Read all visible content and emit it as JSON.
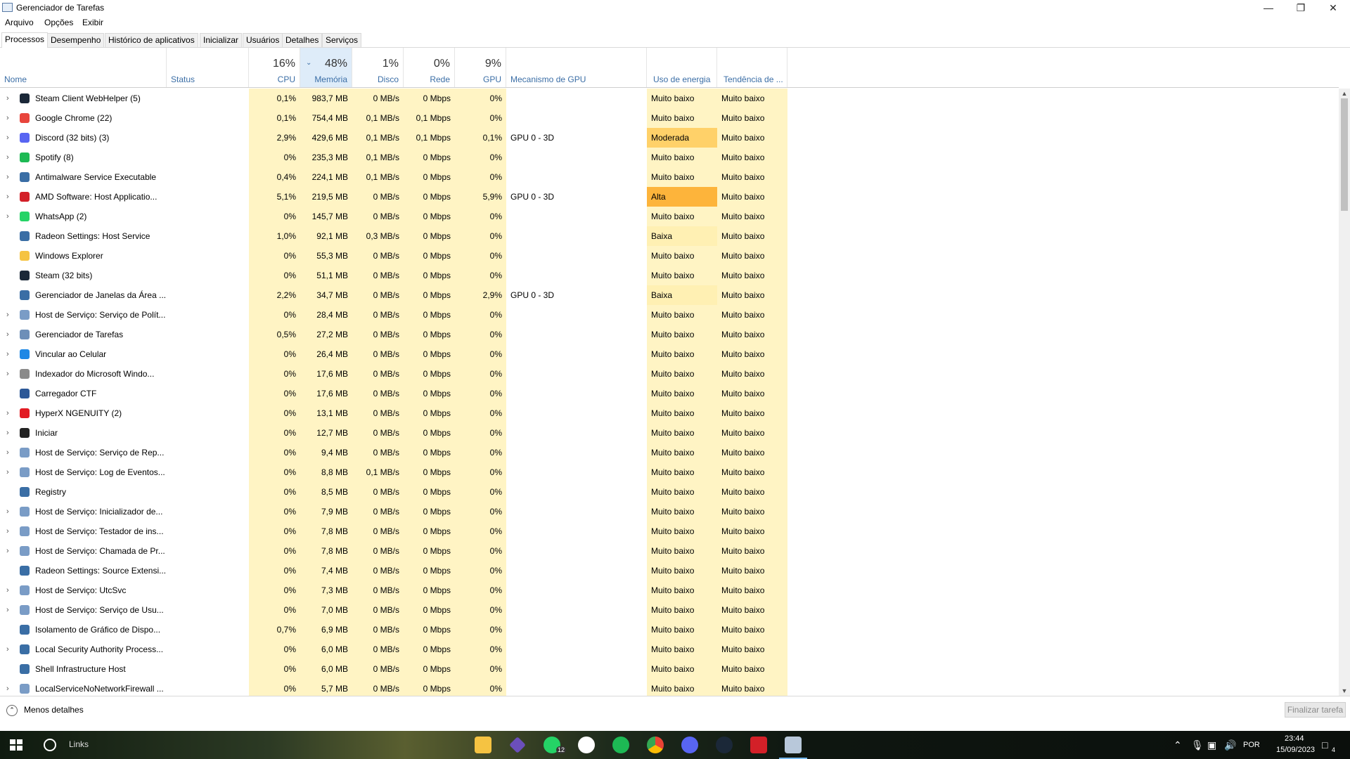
{
  "window": {
    "title": "Gerenciador de Tarefas"
  },
  "menu": [
    "Arquivo",
    "Opções",
    "Exibir"
  ],
  "tabs": [
    "Processos",
    "Desempenho",
    "Histórico de aplicativos",
    "Inicializar",
    "Usuários",
    "Detalhes",
    "Serviços"
  ],
  "headers": {
    "name": "Nome",
    "status": "Status",
    "cpu_pct": "16%",
    "cpu": "CPU",
    "mem_pct": "48%",
    "mem": "Memória",
    "disk_pct": "1%",
    "disk": "Disco",
    "net_pct": "0%",
    "net": "Rede",
    "gpu_pct": "9%",
    "gpu": "GPU",
    "gpu_engine": "Mecanismo de GPU",
    "power": "Uso de energia",
    "power_trend": "Tendência de ..."
  },
  "processes": [
    {
      "name": "Steam Client WebHelper (5)",
      "expand": true,
      "icon": "steam-icon",
      "icon_color": "#1b2838",
      "cpu": "0,1%",
      "mem": "983,7 MB",
      "disk": "0 MB/s",
      "net": "0 Mbps",
      "gpu": "0%",
      "engine": "",
      "power": "Muito baixo",
      "trend": "Muito baixo"
    },
    {
      "name": "Google Chrome (22)",
      "expand": true,
      "icon": "chrome-icon",
      "icon_color": "#e8453c",
      "cpu": "0,1%",
      "mem": "754,4 MB",
      "disk": "0,1 MB/s",
      "net": "0,1 Mbps",
      "gpu": "0%",
      "engine": "",
      "power": "Muito baixo",
      "trend": "Muito baixo"
    },
    {
      "name": "Discord (32 bits) (3)",
      "expand": true,
      "icon": "discord-icon",
      "icon_color": "#5865f2",
      "cpu": "2,9%",
      "mem": "429,6 MB",
      "disk": "0,1 MB/s",
      "net": "0,1 Mbps",
      "gpu": "0,1%",
      "engine": "GPU 0 - 3D",
      "power": "Moderada",
      "trend": "Muito baixo"
    },
    {
      "name": "Spotify (8)",
      "expand": true,
      "icon": "spotify-icon",
      "icon_color": "#1db954",
      "cpu": "0%",
      "mem": "235,3 MB",
      "disk": "0,1 MB/s",
      "net": "0 Mbps",
      "gpu": "0%",
      "engine": "",
      "power": "Muito baixo",
      "trend": "Muito baixo"
    },
    {
      "name": "Antimalware Service Executable",
      "expand": true,
      "icon": "window-icon",
      "icon_color": "#3a6ea5",
      "cpu": "0,4%",
      "mem": "224,1 MB",
      "disk": "0,1 MB/s",
      "net": "0 Mbps",
      "gpu": "0%",
      "engine": "",
      "power": "Muito baixo",
      "trend": "Muito baixo"
    },
    {
      "name": "AMD Software: Host Applicatio...",
      "expand": true,
      "icon": "amd-icon",
      "icon_color": "#d32028",
      "cpu": "5,1%",
      "mem": "219,5 MB",
      "disk": "0 MB/s",
      "net": "0 Mbps",
      "gpu": "5,9%",
      "engine": "GPU 0 - 3D",
      "power": "Alta",
      "trend": "Muito baixo"
    },
    {
      "name": "WhatsApp (2)",
      "expand": true,
      "icon": "whatsapp-icon",
      "icon_color": "#25d366",
      "cpu": "0%",
      "mem": "145,7 MB",
      "disk": "0 MB/s",
      "net": "0 Mbps",
      "gpu": "0%",
      "engine": "",
      "power": "Muito baixo",
      "trend": "Muito baixo"
    },
    {
      "name": "Radeon Settings: Host Service",
      "expand": false,
      "icon": "window-icon",
      "icon_color": "#3a6ea5",
      "cpu": "1,0%",
      "mem": "92,1 MB",
      "disk": "0,3 MB/s",
      "net": "0 Mbps",
      "gpu": "0%",
      "engine": "",
      "power": "Baixa",
      "trend": "Muito baixo"
    },
    {
      "name": "Windows Explorer",
      "expand": false,
      "icon": "folder-icon",
      "icon_color": "#f5c342",
      "cpu": "0%",
      "mem": "55,3 MB",
      "disk": "0 MB/s",
      "net": "0 Mbps",
      "gpu": "0%",
      "engine": "",
      "power": "Muito baixo",
      "trend": "Muito baixo"
    },
    {
      "name": "Steam (32 bits)",
      "expand": false,
      "icon": "steam-icon",
      "icon_color": "#1b2838",
      "cpu": "0%",
      "mem": "51,1 MB",
      "disk": "0 MB/s",
      "net": "0 Mbps",
      "gpu": "0%",
      "engine": "",
      "power": "Muito baixo",
      "trend": "Muito baixo"
    },
    {
      "name": "Gerenciador de Janelas da Área ...",
      "expand": false,
      "icon": "window-icon",
      "icon_color": "#3a6ea5",
      "cpu": "2,2%",
      "mem": "34,7 MB",
      "disk": "0 MB/s",
      "net": "0 Mbps",
      "gpu": "2,9%",
      "engine": "GPU 0 - 3D",
      "power": "Baixa",
      "trend": "Muito baixo"
    },
    {
      "name": "Host de Serviço: Serviço de Polít...",
      "expand": true,
      "icon": "gear-icon",
      "icon_color": "#7a9cc6",
      "cpu": "0%",
      "mem": "28,4 MB",
      "disk": "0 MB/s",
      "net": "0 Mbps",
      "gpu": "0%",
      "engine": "",
      "power": "Muito baixo",
      "trend": "Muito baixo"
    },
    {
      "name": "Gerenciador de Tarefas",
      "expand": true,
      "icon": "taskmgr-icon",
      "icon_color": "#6d8fb8",
      "cpu": "0,5%",
      "mem": "27,2 MB",
      "disk": "0 MB/s",
      "net": "0 Mbps",
      "gpu": "0%",
      "engine": "",
      "power": "Muito baixo",
      "trend": "Muito baixo"
    },
    {
      "name": "Vincular ao Celular",
      "expand": true,
      "icon": "phone-link-icon",
      "icon_color": "#1e88e5",
      "cpu": "0%",
      "mem": "26,4 MB",
      "disk": "0 MB/s",
      "net": "0 Mbps",
      "gpu": "0%",
      "engine": "",
      "power": "Muito baixo",
      "trend": "Muito baixo"
    },
    {
      "name": "Indexador do Microsoft Windo...",
      "expand": true,
      "icon": "indexer-icon",
      "icon_color": "#8a8a8a",
      "cpu": "0%",
      "mem": "17,6 MB",
      "disk": "0 MB/s",
      "net": "0 Mbps",
      "gpu": "0%",
      "engine": "",
      "power": "Muito baixo",
      "trend": "Muito baixo"
    },
    {
      "name": "Carregador CTF",
      "expand": false,
      "icon": "pen-icon",
      "icon_color": "#2b5797",
      "cpu": "0%",
      "mem": "17,6 MB",
      "disk": "0 MB/s",
      "net": "0 Mbps",
      "gpu": "0%",
      "engine": "",
      "power": "Muito baixo",
      "trend": "Muito baixo"
    },
    {
      "name": "HyperX NGENUITY (2)",
      "expand": true,
      "icon": "hyperx-icon",
      "icon_color": "#e21b23",
      "cpu": "0%",
      "mem": "13,1 MB",
      "disk": "0 MB/s",
      "net": "0 Mbps",
      "gpu": "0%",
      "engine": "",
      "power": "Muito baixo",
      "trend": "Muito baixo"
    },
    {
      "name": "Iniciar",
      "expand": true,
      "icon": "start-window-icon",
      "icon_color": "#222222",
      "cpu": "0%",
      "mem": "12,7 MB",
      "disk": "0 MB/s",
      "net": "0 Mbps",
      "gpu": "0%",
      "engine": "",
      "power": "Muito baixo",
      "trend": "Muito baixo"
    },
    {
      "name": "Host de Serviço: Serviço de Rep...",
      "expand": true,
      "icon": "gear-icon",
      "icon_color": "#7a9cc6",
      "cpu": "0%",
      "mem": "9,4 MB",
      "disk": "0 MB/s",
      "net": "0 Mbps",
      "gpu": "0%",
      "engine": "",
      "power": "Muito baixo",
      "trend": "Muito baixo"
    },
    {
      "name": "Host de Serviço: Log de Eventos...",
      "expand": true,
      "icon": "gear-icon",
      "icon_color": "#7a9cc6",
      "cpu": "0%",
      "mem": "8,8 MB",
      "disk": "0,1 MB/s",
      "net": "0 Mbps",
      "gpu": "0%",
      "engine": "",
      "power": "Muito baixo",
      "trend": "Muito baixo"
    },
    {
      "name": "Registry",
      "expand": false,
      "icon": "window-icon",
      "icon_color": "#3a6ea5",
      "cpu": "0%",
      "mem": "8,5 MB",
      "disk": "0 MB/s",
      "net": "0 Mbps",
      "gpu": "0%",
      "engine": "",
      "power": "Muito baixo",
      "trend": "Muito baixo"
    },
    {
      "name": "Host de Serviço: Inicializador de...",
      "expand": true,
      "icon": "gear-icon",
      "icon_color": "#7a9cc6",
      "cpu": "0%",
      "mem": "7,9 MB",
      "disk": "0 MB/s",
      "net": "0 Mbps",
      "gpu": "0%",
      "engine": "",
      "power": "Muito baixo",
      "trend": "Muito baixo"
    },
    {
      "name": "Host de Serviço: Testador de ins...",
      "expand": true,
      "icon": "gear-icon",
      "icon_color": "#7a9cc6",
      "cpu": "0%",
      "mem": "7,8 MB",
      "disk": "0 MB/s",
      "net": "0 Mbps",
      "gpu": "0%",
      "engine": "",
      "power": "Muito baixo",
      "trend": "Muito baixo"
    },
    {
      "name": "Host de Serviço: Chamada de Pr...",
      "expand": true,
      "icon": "gear-icon",
      "icon_color": "#7a9cc6",
      "cpu": "0%",
      "mem": "7,8 MB",
      "disk": "0 MB/s",
      "net": "0 Mbps",
      "gpu": "0%",
      "engine": "",
      "power": "Muito baixo",
      "trend": "Muito baixo"
    },
    {
      "name": "Radeon Settings: Source Extensi...",
      "expand": false,
      "icon": "window-icon",
      "icon_color": "#3a6ea5",
      "cpu": "0%",
      "mem": "7,4 MB",
      "disk": "0 MB/s",
      "net": "0 Mbps",
      "gpu": "0%",
      "engine": "",
      "power": "Muito baixo",
      "trend": "Muito baixo"
    },
    {
      "name": "Host de Serviço: UtcSvc",
      "expand": true,
      "icon": "gear-icon",
      "icon_color": "#7a9cc6",
      "cpu": "0%",
      "mem": "7,3 MB",
      "disk": "0 MB/s",
      "net": "0 Mbps",
      "gpu": "0%",
      "engine": "",
      "power": "Muito baixo",
      "trend": "Muito baixo"
    },
    {
      "name": "Host de Serviço: Serviço de Usu...",
      "expand": true,
      "icon": "gear-icon",
      "icon_color": "#7a9cc6",
      "cpu": "0%",
      "mem": "7,0 MB",
      "disk": "0 MB/s",
      "net": "0 Mbps",
      "gpu": "0%",
      "engine": "",
      "power": "Muito baixo",
      "trend": "Muito baixo"
    },
    {
      "name": "Isolamento de Gráfico de Dispo...",
      "expand": false,
      "icon": "window-icon",
      "icon_color": "#3a6ea5",
      "cpu": "0,7%",
      "mem": "6,9 MB",
      "disk": "0 MB/s",
      "net": "0 Mbps",
      "gpu": "0%",
      "engine": "",
      "power": "Muito baixo",
      "trend": "Muito baixo"
    },
    {
      "name": "Local Security Authority Process...",
      "expand": true,
      "icon": "window-icon",
      "icon_color": "#3a6ea5",
      "cpu": "0%",
      "mem": "6,0 MB",
      "disk": "0 MB/s",
      "net": "0 Mbps",
      "gpu": "0%",
      "engine": "",
      "power": "Muito baixo",
      "trend": "Muito baixo"
    },
    {
      "name": "Shell Infrastructure Host",
      "expand": false,
      "icon": "window-icon",
      "icon_color": "#3a6ea5",
      "cpu": "0%",
      "mem": "6,0 MB",
      "disk": "0 MB/s",
      "net": "0 Mbps",
      "gpu": "0%",
      "engine": "",
      "power": "Muito baixo",
      "trend": "Muito baixo"
    },
    {
      "name": "LocalServiceNoNetworkFirewall ...",
      "expand": true,
      "icon": "gear-icon",
      "icon_color": "#7a9cc6",
      "cpu": "0%",
      "mem": "5,7 MB",
      "disk": "0 MB/s",
      "net": "0 Mbps",
      "gpu": "0%",
      "engine": "",
      "power": "Muito baixo",
      "trend": "Muito baixo"
    }
  ],
  "footer": {
    "less_details": "Menos detalhes",
    "end_task": "Finalizar tarefa"
  },
  "taskbar": {
    "search_text": "Links",
    "whatsapp_badge": "12",
    "language": "POR",
    "time": "23:44",
    "date": "15/09/2023",
    "notifications": "4"
  },
  "colors": {
    "accent": "#3b6ea6",
    "cell_bg": "#fff4c4",
    "power_moderate": "#ffd169",
    "power_high": "#fdb43b"
  }
}
